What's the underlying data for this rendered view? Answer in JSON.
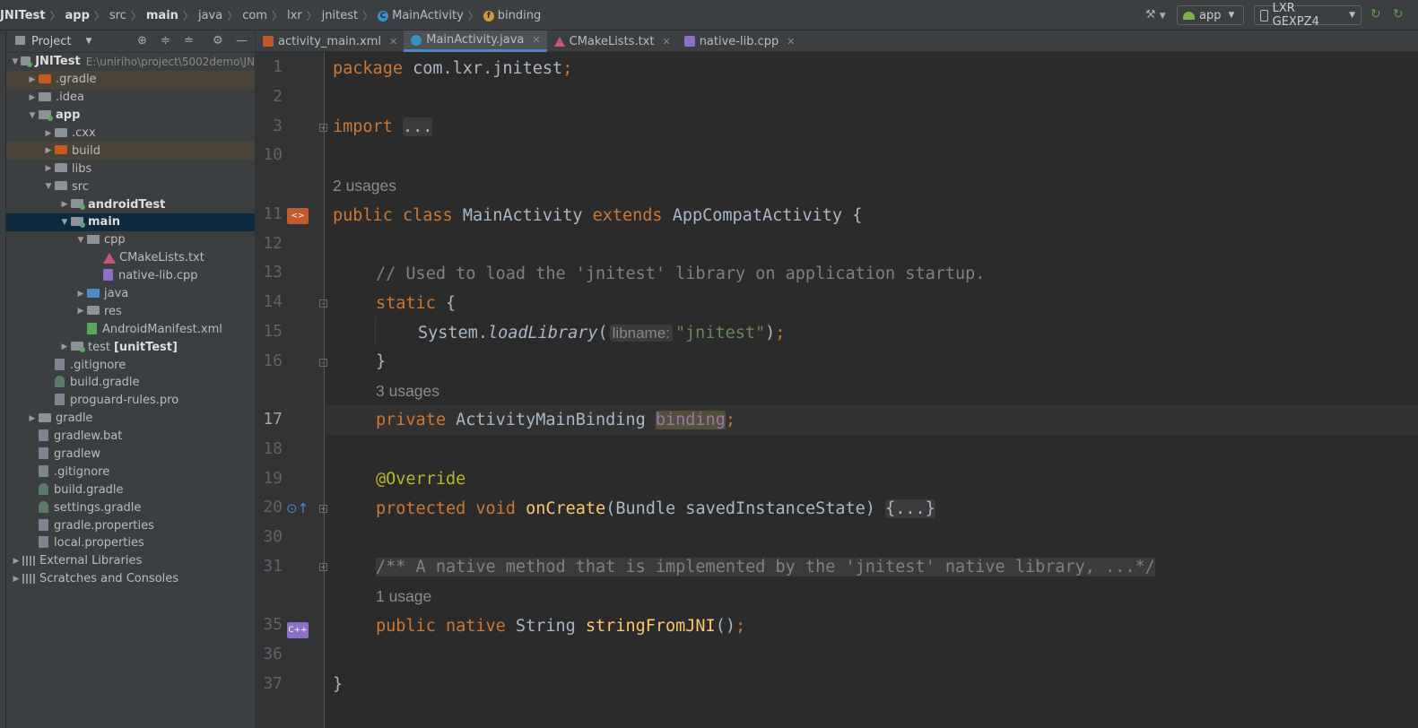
{
  "breadcrumbs": [
    {
      "label": "JNITest",
      "bold": true
    },
    {
      "label": "app",
      "bold": true
    },
    {
      "label": "src"
    },
    {
      "label": "main",
      "bold": true
    },
    {
      "label": "java"
    },
    {
      "label": "com"
    },
    {
      "label": "lxr"
    },
    {
      "label": "jnitest"
    },
    {
      "label": "MainActivity",
      "icon": "class-icon"
    },
    {
      "label": "binding",
      "icon": "field-icon"
    }
  ],
  "toolbar": {
    "run_config": "app",
    "device": "LXR GEXPZ4"
  },
  "project_panel": {
    "title": "Project",
    "root_label": "JNITest",
    "root_path": "E:\\uniriho\\project\\5002demo\\JN",
    "items": [
      {
        "label": ".gradle",
        "depth": 1,
        "arrow": "right",
        "icon": "folder-orange",
        "hl": "brown"
      },
      {
        "label": ".idea",
        "depth": 1,
        "arrow": "right",
        "icon": "folder"
      },
      {
        "label": "app",
        "depth": 1,
        "arrow": "down",
        "icon": "module",
        "bold": true
      },
      {
        "label": ".cxx",
        "depth": 2,
        "arrow": "right",
        "icon": "folder"
      },
      {
        "label": "build",
        "depth": 2,
        "arrow": "right",
        "icon": "folder-orange",
        "hl": "brown"
      },
      {
        "label": "libs",
        "depth": 2,
        "arrow": "right",
        "icon": "folder"
      },
      {
        "label": "src",
        "depth": 2,
        "arrow": "down",
        "icon": "folder"
      },
      {
        "label": "androidTest",
        "depth": 3,
        "arrow": "right",
        "icon": "module",
        "bold": true
      },
      {
        "label": "main",
        "depth": 3,
        "arrow": "down",
        "icon": "module",
        "bold": true,
        "hl": "sel"
      },
      {
        "label": "cpp",
        "depth": 4,
        "arrow": "down",
        "icon": "folder"
      },
      {
        "label": "CMakeLists.txt",
        "depth": 5,
        "arrow": "",
        "icon": "cmake"
      },
      {
        "label": "native-lib.cpp",
        "depth": 5,
        "arrow": "",
        "icon": "cpp"
      },
      {
        "label": "java",
        "depth": 4,
        "arrow": "right",
        "icon": "folder-blue"
      },
      {
        "label": "res",
        "depth": 4,
        "arrow": "right",
        "icon": "folder"
      },
      {
        "label": "AndroidManifest.xml",
        "depth": 4,
        "arrow": "",
        "icon": "xml"
      },
      {
        "label": "test",
        "suffix": "[unitTest]",
        "depth": 3,
        "arrow": "right",
        "icon": "module"
      },
      {
        "label": ".gitignore",
        "depth": 2,
        "arrow": "",
        "icon": "file"
      },
      {
        "label": "build.gradle",
        "depth": 2,
        "arrow": "",
        "icon": "gradle"
      },
      {
        "label": "proguard-rules.pro",
        "depth": 2,
        "arrow": "",
        "icon": "file"
      },
      {
        "label": "gradle",
        "depth": 1,
        "arrow": "right",
        "icon": "folder"
      },
      {
        "label": "gradlew.bat",
        "depth": 1,
        "arrow": "",
        "icon": "file"
      },
      {
        "label": "gradlew",
        "depth": 1,
        "arrow": "",
        "icon": "file"
      },
      {
        "label": ".gitignore",
        "depth": 1,
        "arrow": "",
        "icon": "file"
      },
      {
        "label": "build.gradle",
        "depth": 1,
        "arrow": "",
        "icon": "gradle"
      },
      {
        "label": "settings.gradle",
        "depth": 1,
        "arrow": "",
        "icon": "gradle"
      },
      {
        "label": "gradle.properties",
        "depth": 1,
        "arrow": "",
        "icon": "file"
      },
      {
        "label": "local.properties",
        "depth": 1,
        "arrow": "",
        "icon": "file"
      },
      {
        "label": "External Libraries",
        "depth": 0,
        "arrow": "right",
        "icon": "library"
      },
      {
        "label": "Scratches and Consoles",
        "depth": 0,
        "arrow": "right",
        "icon": "scratch"
      }
    ]
  },
  "tabs": [
    {
      "label": "activity_main.xml",
      "icon": "xml",
      "active": false
    },
    {
      "label": "MainActivity.java",
      "icon": "java",
      "active": true
    },
    {
      "label": "CMakeLists.txt",
      "icon": "cmake",
      "active": false
    },
    {
      "label": "native-lib.cpp",
      "icon": "cpp",
      "active": false,
      "closable": false
    }
  ],
  "editor": {
    "line_numbers": [
      "1",
      "2",
      "3",
      "10",
      "",
      "11",
      "12",
      "13",
      "14",
      "15",
      "16",
      "",
      "17",
      "18",
      "19",
      "20",
      "30",
      "31",
      "",
      "35",
      "36",
      "37"
    ],
    "code": {
      "l1_kw": "package",
      "l1_rest": " com.lxr.jnitest",
      "l1_semi": ";",
      "l3_kw": "import",
      "l3_fold": "...",
      "usage_2": "2 usages",
      "l11_kw1": "public",
      "l11_kw2": "class",
      "l11_name": "MainActivity",
      "l11_kw3": "extends",
      "l11_parent": "AppCompatActivity {",
      "l13_comment": "// Used to load the 'jnitest' library on application startup.",
      "l14_kw": "static",
      "l14_rest": " {",
      "l15_obj": "System.",
      "l15_method": "loadLibrary",
      "l15_paren": "(",
      "l15_hint": "libname:",
      "l15_str": "\"jnitest\"",
      "l15_close": ")",
      "l15_semi": ";",
      "l16": "}",
      "usage_3": "3 usages",
      "l17_kw": "private",
      "l17_type": " ActivityMainBinding ",
      "l17_field": "binding",
      "l17_semi": ";",
      "l19_ann": "@Override",
      "l20_kw1": "protected",
      "l20_kw2": "void",
      "l20_fn": "onCreate",
      "l20_params": "(Bundle savedInstanceState) ",
      "l20_fold": "{...}",
      "l31_comment": "/** A native method that is implemented by the 'jnitest' native library, ...*/",
      "usage_1": "1 usage",
      "l35_kw1": "public",
      "l35_kw2": "native",
      "l35_type": " String ",
      "l35_fn": "stringFromJNI",
      "l35_rest": "()",
      "l35_semi": ";",
      "l37": "}"
    }
  }
}
